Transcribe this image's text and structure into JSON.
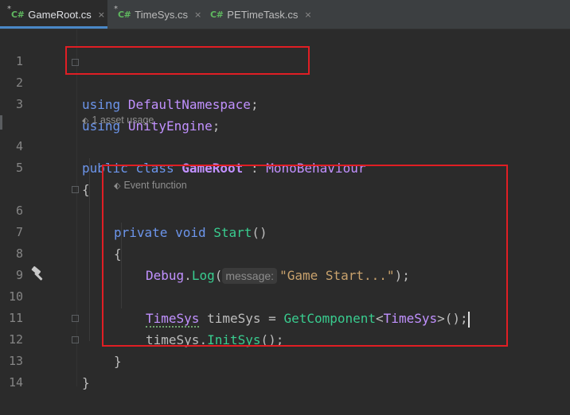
{
  "tabs": [
    {
      "icon": "C#",
      "modified": "*",
      "label": "GameRoot.cs",
      "close": "×",
      "active": true
    },
    {
      "icon": "C#",
      "modified": "*",
      "label": "TimeSys.cs",
      "close": "×",
      "active": false
    },
    {
      "icon": "C#",
      "modified": "",
      "label": "PETimeTask.cs",
      "close": "×",
      "active": false
    }
  ],
  "hints": {
    "asset_usage": "1 asset usage",
    "event_function": "Event function"
  },
  "lines": {
    "l1": {
      "num": "1"
    },
    "l2": {
      "num": "2",
      "kw": "using",
      "ns": "DefaultNamespace",
      "end": ";"
    },
    "l3": {
      "num": "3",
      "kw": "using",
      "ns": "UnityEngine",
      "end": ";"
    },
    "l4": {
      "num": "4",
      "kw1": "public",
      "kw2": "class",
      "cls": "GameRoot",
      "colon": ":",
      "base": "MonoBehaviour"
    },
    "l5": {
      "num": "5",
      "brace": "{"
    },
    "l6": {
      "num": "6",
      "kw1": "private",
      "kw2": "void",
      "method": "Start",
      "parens": "()"
    },
    "l7": {
      "num": "7",
      "brace": "{"
    },
    "l8": {
      "num": "8",
      "cls": "Debug",
      "dot": ".",
      "method": "Log",
      "open": "(",
      "param_hint": "message:",
      "str": "\"Game Start...\"",
      "close": ");"
    },
    "l9": {
      "num": "9"
    },
    "l10": {
      "num": "10",
      "type": "TimeSys",
      "var": "timeSys",
      "eq": "=",
      "method": "GetComponent",
      "lt": "<",
      "generic": "TimeSys",
      "gt": ">",
      "end": "();"
    },
    "l11": {
      "num": "11",
      "var": "timeSys",
      "dot": ".",
      "method": "InitSys",
      "end": "();"
    },
    "l12": {
      "num": "12",
      "brace": "}"
    },
    "l13": {
      "num": "13",
      "brace": "}"
    },
    "l14": {
      "num": "14"
    }
  },
  "colors": {
    "keyword": "#6c95eb",
    "type": "#c191ff",
    "method": "#39cc8f",
    "string": "#c9a26d",
    "highlight_box": "#e01e24"
  },
  "icons": [
    "csharp-file-icon",
    "close-icon",
    "usages-icon",
    "event-function-icon",
    "hammer-icon",
    "fold-icon"
  ]
}
